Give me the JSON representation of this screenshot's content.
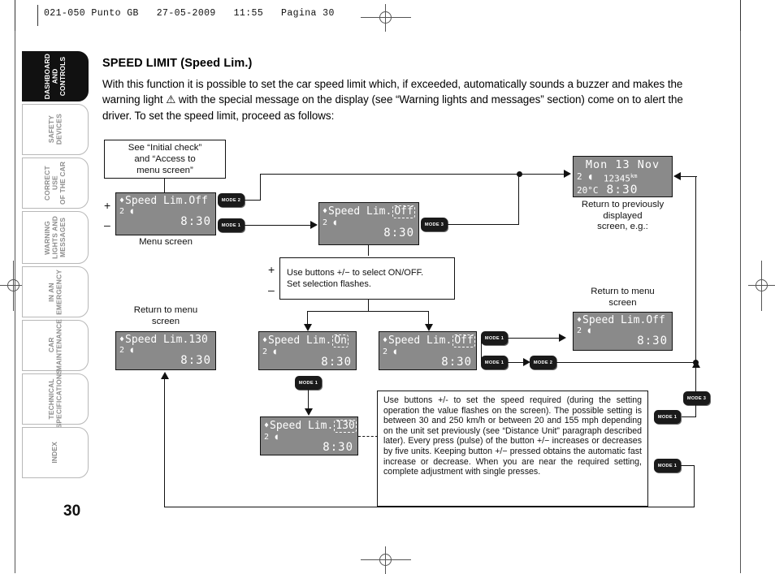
{
  "running_head": "021-050 Punto GB   27-05-2009   11:55   Pagina 30",
  "page_number": "30",
  "sidebar": {
    "items": [
      {
        "label": "DASHBOARD\nAND\nCONTROLS",
        "active": true
      },
      {
        "label": "SAFETY\nDEVICES",
        "active": false
      },
      {
        "label": "CORRECT USE\nOF THE CAR",
        "active": false
      },
      {
        "label": "WARNING\nLIGHTS AND\nMESSAGES",
        "active": false
      },
      {
        "label": "IN AN\nEMERGENCY",
        "active": false
      },
      {
        "label": "CAR\nMAINTENANCE",
        "active": false
      },
      {
        "label": "TECHNICAL\nSPECIFICATIONS",
        "active": false
      },
      {
        "label": "INDEX",
        "active": false
      }
    ]
  },
  "content": {
    "heading": "SPEED LIMIT (Speed Lim.)",
    "paragraph": "With this function it is possible to set the car speed limit which, if exceeded, automatically sounds a buzzer and makes the warning light ⚠ with the special message on the display (see “Warning lights and messages” section) come on to alert the driver. To set the speed limit, proceed as follows:"
  },
  "diagram": {
    "initial_check_box": "See “Initial check”\nand “Access to\nmenu screen”",
    "select_box": "Use buttons +/− to select ON/OFF.\nSet selection flashes.",
    "note_box": "Use buttons +/- to set the speed required (during the setting operation the value flashes on the screen). The possible setting is between 30 and 250 km/h or between 20 and 155 mph depending on the unit set previously (see “Distance Unit” paragraph described later). Every press (pulse) of the button +/− increases or decreases by five units. Keeping button +/− pressed obtains the automatic fast increase or decrease. When you are near the required setting, complete adjustment with single presses.",
    "captions": {
      "menu_screen": "Menu screen",
      "return_previous": "Return to previously\ndisplayed\nscreen, e.g.:",
      "return_menu_left": "Return to menu\nscreen",
      "return_menu_right": "Return to menu\nscreen"
    },
    "plus": "+",
    "minus": "–",
    "mode_buttons": [
      {
        "label": "MODE 2"
      },
      {
        "label": "MODE 1"
      },
      {
        "label": "MODE 3"
      },
      {
        "label": "MODE 1"
      },
      {
        "label": "MODE 1"
      },
      {
        "label": "MODE 1"
      },
      {
        "label": "MODE 2"
      },
      {
        "label": "MODE 3"
      },
      {
        "label": "MODE 1"
      },
      {
        "label": "MODE 1"
      }
    ],
    "screens": {
      "menu": {
        "title": "Speed Lim.",
        "value": "Off",
        "gear": "2",
        "time": "8:30",
        "selected": false
      },
      "edit_off": {
        "title": "Speed Lim.",
        "value": "Off",
        "gear": "2",
        "time": "8:30",
        "selected": true
      },
      "set_on": {
        "title": "Speed Lim.",
        "value": "On",
        "gear": "2",
        "time": "8:30",
        "selected": true
      },
      "set_off": {
        "title": "Speed Lim.",
        "value": "Off",
        "gear": "2",
        "time": "8:30",
        "selected": true
      },
      "value_130": {
        "title": "Speed Lim.",
        "value": "130",
        "gear": "2",
        "time": "8:30",
        "selected": true
      },
      "result_130": {
        "title": "Speed Lim.",
        "value": "130",
        "gear": "2",
        "time": "8:30",
        "selected": false
      },
      "result_off": {
        "title": "Speed Lim.",
        "value": "Off",
        "gear": "2",
        "time": "8:30",
        "selected": false
      },
      "clock": {
        "date": "Mon 13 Nov",
        "gear": "2",
        "odometer": "12345",
        "odometer_unit": "km",
        "temperature": "20°C",
        "time": "8:30"
      }
    }
  }
}
